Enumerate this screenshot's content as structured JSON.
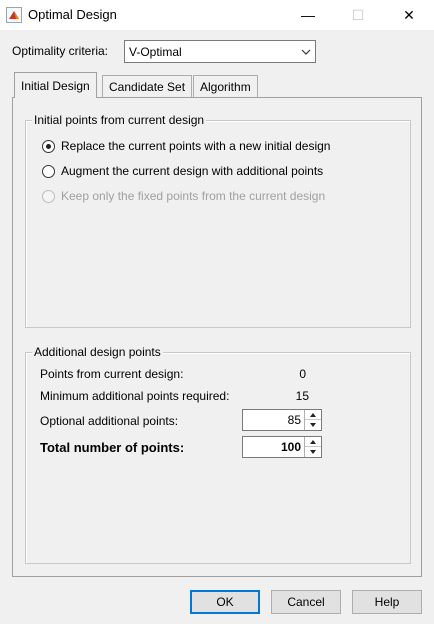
{
  "window": {
    "title": "Optimal Design",
    "minimize_label": "—",
    "maximize_label": "☐",
    "close_label": "✕"
  },
  "criteria": {
    "label": "Optimality criteria:",
    "value": "V-Optimal"
  },
  "tabs": [
    {
      "label": "Initial Design",
      "active": true
    },
    {
      "label": "Candidate Set",
      "active": false
    },
    {
      "label": "Algorithm",
      "active": false
    }
  ],
  "initial_points": {
    "title": "Initial points from current design",
    "options": [
      {
        "label": "Replace the current points with a new initial design",
        "checked": true,
        "enabled": true
      },
      {
        "label": "Augment the current design with additional points",
        "checked": false,
        "enabled": true
      },
      {
        "label": "Keep only the fixed points from the current design",
        "checked": false,
        "enabled": false
      }
    ]
  },
  "additional_points": {
    "title": "Additional design points",
    "current_label": "Points from current design:",
    "current_value": "0",
    "min_label": "Minimum additional points required:",
    "min_value": "15",
    "optional_label": "Optional additional points:",
    "optional_value": "85",
    "total_label": "Total number of points:",
    "total_value": "100"
  },
  "buttons": {
    "ok": "OK",
    "cancel": "Cancel",
    "help": "Help"
  },
  "colors": {
    "accent": "#0078d7",
    "background": "#f0f0f0"
  }
}
